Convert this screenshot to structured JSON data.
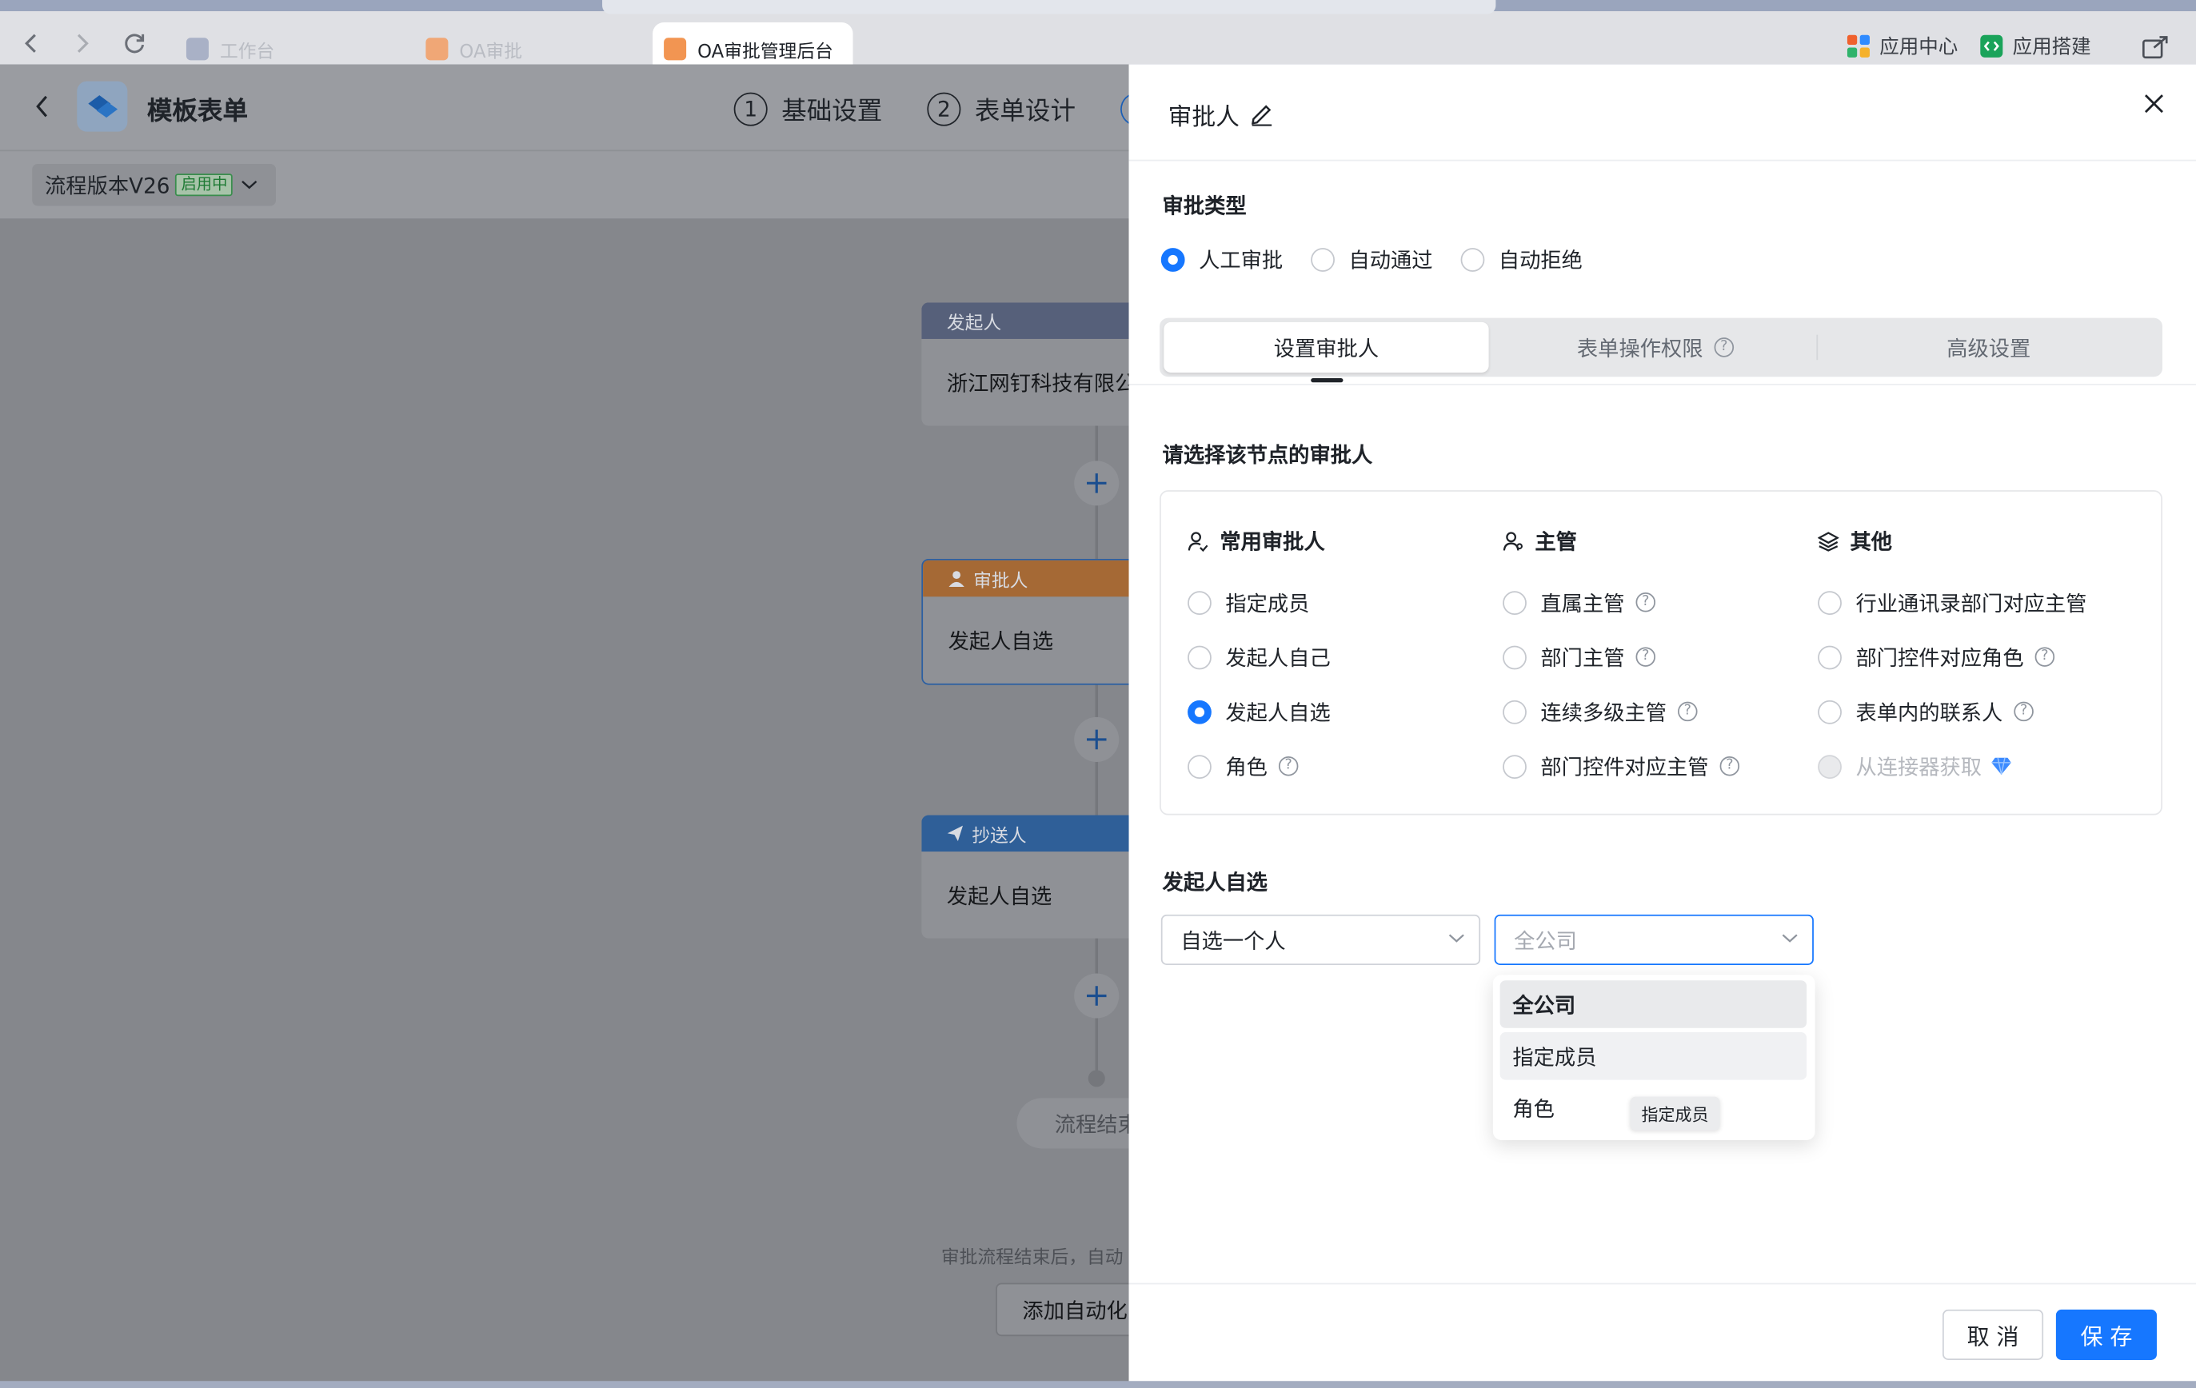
{
  "browser": {
    "tabs": [
      {
        "label": "工作台"
      },
      {
        "label": "OA审批"
      },
      {
        "label": "OA审批管理后台"
      }
    ],
    "right": {
      "app_center": "应用中心",
      "app_builder": "应用搭建"
    }
  },
  "page": {
    "title": "模板表单",
    "steps": [
      {
        "num": "1",
        "label": "基础设置"
      },
      {
        "num": "2",
        "label": "表单设计"
      }
    ],
    "version": {
      "label": "流程版本V26",
      "badge": "启用中"
    },
    "flow": {
      "initiator": {
        "header": "发起人",
        "body": "浙江网钉科技有限公"
      },
      "approver": {
        "header": "审批人",
        "body": "发起人自选"
      },
      "cc": {
        "header": "抄送人",
        "body": "发起人自选"
      },
      "end": "流程结束"
    },
    "bottom_note": "审批流程结束后，自动",
    "bottom_button": "添加自动化"
  },
  "drawer": {
    "title": "审批人",
    "approval_type": {
      "label": "审批类型",
      "options": [
        "人工审批",
        "自动通过",
        "自动拒绝"
      ],
      "selected": "人工审批"
    },
    "tabs": [
      "设置审批人",
      "表单操作权限",
      "高级设置"
    ],
    "select_label": "请选择该节点的审批人",
    "columns": {
      "common": {
        "title": "常用审批人",
        "items": [
          "指定成员",
          "发起人自己",
          "发起人自选",
          "角色"
        ]
      },
      "supervisor": {
        "title": "主管",
        "items": [
          "直属主管",
          "部门主管",
          "连续多级主管",
          "部门控件对应主管"
        ]
      },
      "other": {
        "title": "其他",
        "items": [
          "行业通讯录部门对应主管",
          "部门控件对应角色",
          "表单内的联系人",
          "从连接器获取"
        ]
      }
    },
    "selected_approver": "发起人自选",
    "self_select": {
      "label": "发起人自选",
      "mode_value": "自选一个人",
      "scope_placeholder": "全公司",
      "options": [
        "全公司",
        "指定成员",
        "角色"
      ],
      "tooltip": "指定成员"
    },
    "footer": {
      "cancel": "取 消",
      "save": "保 存"
    },
    "colors": {
      "primary": "#1677ff",
      "approver_header": "#c07a3c",
      "cc_header": "#3b72b4",
      "initiator_header": "#56607a"
    }
  }
}
